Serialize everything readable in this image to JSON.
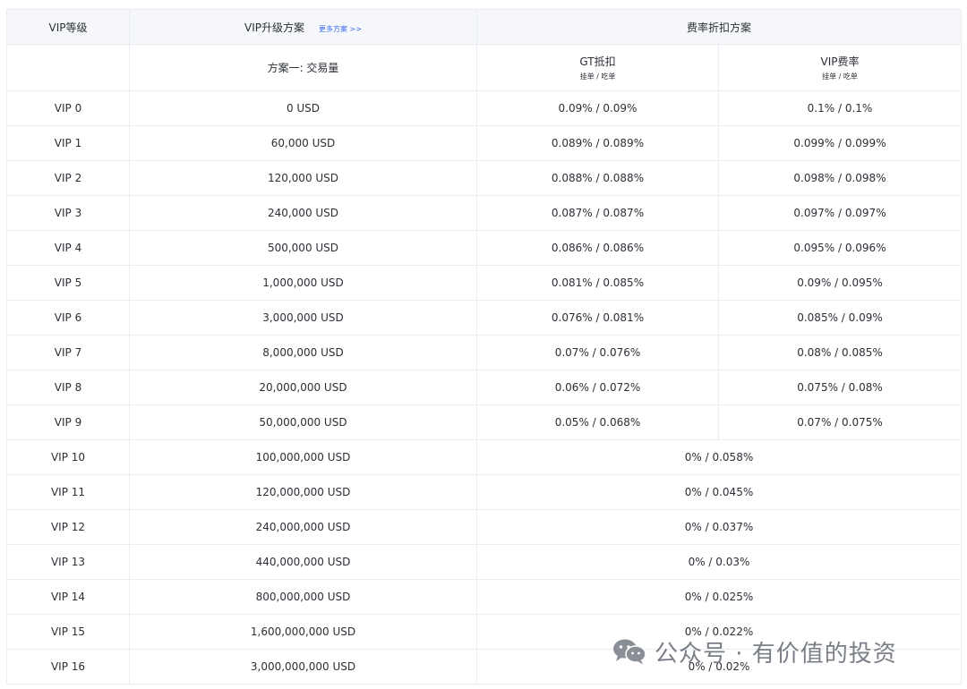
{
  "header": {
    "level_col": "VIP等级",
    "upgrade_col": "VIP升级方案",
    "more_link": "更多方案 >>",
    "fee_col": "费率折扣方案"
  },
  "subheader": {
    "plan": "方案一: 交易量",
    "gt_title": "GT抵扣",
    "gt_sub": "挂单 / 吃单",
    "vip_title": "VIP费率",
    "vip_sub": "挂单 / 吃单"
  },
  "rows": [
    {
      "level": "VIP 0",
      "volume": "0 USD",
      "gt": "0.09% / 0.09%",
      "vip": "0.1% / 0.1%"
    },
    {
      "level": "VIP 1",
      "volume": "60,000 USD",
      "gt": "0.089% / 0.089%",
      "vip": "0.099% / 0.099%"
    },
    {
      "level": "VIP 2",
      "volume": "120,000 USD",
      "gt": "0.088% / 0.088%",
      "vip": "0.098% / 0.098%"
    },
    {
      "level": "VIP 3",
      "volume": "240,000 USD",
      "gt": "0.087% / 0.087%",
      "vip": "0.097% / 0.097%"
    },
    {
      "level": "VIP 4",
      "volume": "500,000 USD",
      "gt": "0.086% / 0.086%",
      "vip": "0.095% / 0.096%"
    },
    {
      "level": "VIP 5",
      "volume": "1,000,000 USD",
      "gt": "0.081% / 0.085%",
      "vip": "0.09% / 0.095%"
    },
    {
      "level": "VIP 6",
      "volume": "3,000,000 USD",
      "gt": "0.076% / 0.081%",
      "vip": "0.085% / 0.09%"
    },
    {
      "level": "VIP 7",
      "volume": "8,000,000 USD",
      "gt": "0.07% / 0.076%",
      "vip": "0.08% / 0.085%"
    },
    {
      "level": "VIP 8",
      "volume": "20,000,000 USD",
      "gt": "0.06% / 0.072%",
      "vip": "0.075% / 0.08%"
    },
    {
      "level": "VIP 9",
      "volume": "50,000,000 USD",
      "gt": "0.05% / 0.068%",
      "vip": "0.07% / 0.075%"
    },
    {
      "level": "VIP 10",
      "volume": "100,000,000 USD",
      "merged": "0% / 0.058%"
    },
    {
      "level": "VIP 11",
      "volume": "120,000,000 USD",
      "merged": "0% / 0.045%"
    },
    {
      "level": "VIP 12",
      "volume": "240,000,000 USD",
      "merged": "0% / 0.037%"
    },
    {
      "level": "VIP 13",
      "volume": "440,000,000 USD",
      "merged": "0% / 0.03%"
    },
    {
      "level": "VIP 14",
      "volume": "800,000,000 USD",
      "merged": "0% / 0.025%"
    },
    {
      "level": "VIP 15",
      "volume": "1,600,000,000 USD",
      "merged": "0% / 0.022%"
    },
    {
      "level": "VIP 16",
      "volume": "3,000,000,000 USD",
      "merged": "0% / 0.02%"
    }
  ],
  "watermark": {
    "icon": "wechat-icon",
    "text": "公众号 · 有价值的投资"
  },
  "colors": {
    "header_bg": "#f5f7fb",
    "border": "#e9ecf2",
    "link": "#3a6df0",
    "text": "#2b2f36",
    "watermark": "#7a7f87"
  }
}
